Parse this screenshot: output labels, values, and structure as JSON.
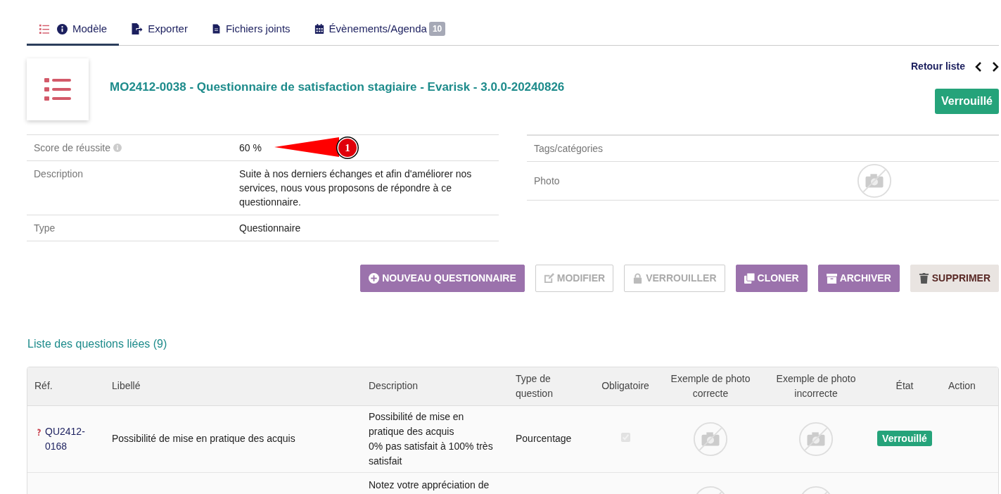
{
  "tabs": [
    {
      "kind": "model",
      "label": "Modèle",
      "selected": true
    },
    {
      "kind": "export",
      "label": "Exporter",
      "selected": false
    },
    {
      "kind": "files",
      "label": "Fichiers joints",
      "selected": false
    },
    {
      "kind": "agenda",
      "label": "Évènements/Agenda",
      "badge": "10",
      "selected": false
    }
  ],
  "header": {
    "title": "MO2412-0038 - Questionnaire de satisfaction stagiaire - Evarisk - 3.0.0-20240826",
    "back_link": "Retour liste",
    "status": "Verrouillé"
  },
  "fields_left": [
    {
      "label": "Score de réussite",
      "info": true,
      "value": "60 %"
    },
    {
      "label": "Description",
      "info": false,
      "value": "Suite à nos derniers échanges et afin d'améliorer nos services, nous vous proposons de répondre à ce questionnaire."
    },
    {
      "label": "Type",
      "info": false,
      "value": "Questionnaire"
    }
  ],
  "annotation": {
    "label": "1"
  },
  "fields_right": [
    {
      "label": "Tags/catégories",
      "kind": "text"
    },
    {
      "label": "Photo",
      "kind": "photo"
    }
  ],
  "actions": [
    {
      "label": "NOUVEAU QUESTIONNAIRE",
      "kind": "primary"
    },
    {
      "label": "MODIFIER",
      "kind": "disabled"
    },
    {
      "label": "VERROUILLER",
      "kind": "disabled"
    },
    {
      "label": "CLONER",
      "kind": "primary"
    },
    {
      "label": "ARCHIVER",
      "kind": "primary"
    },
    {
      "label": "SUPPRIMER",
      "kind": "danger"
    }
  ],
  "questions": {
    "title": "Liste des questions liées (9)",
    "columns": [
      "Réf.",
      "Libellé",
      "Description",
      "Type de question",
      "Obligatoire",
      "Exemple de photo correcte",
      "Exemple de photo incorrecte",
      "État",
      "Action"
    ],
    "rows": [
      {
        "ref": "QU2412-0168",
        "label": "Possibilité de mise en pratique des acquis",
        "description": [
          "Possibilité de mise en pratique des acquis",
          "0% pas satisfait à 100% très satisfait"
        ],
        "type": "Pourcentage",
        "required": true,
        "status": "Verrouillé"
      },
      {
        "description": [
          "Notez votre appréciation de"
        ]
      }
    ]
  }
}
